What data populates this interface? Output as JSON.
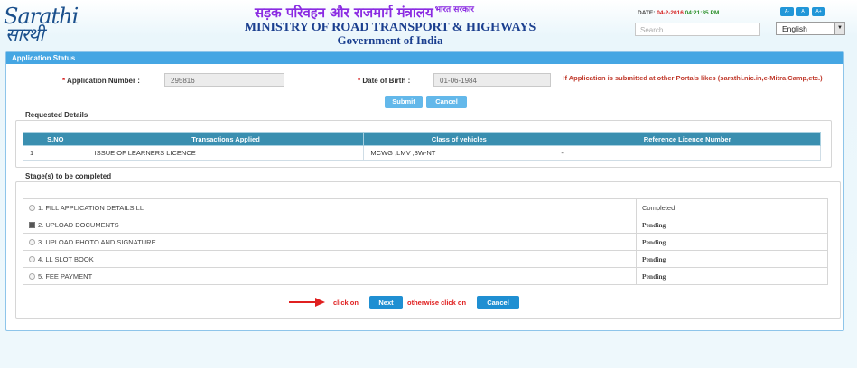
{
  "header": {
    "logo_en": "Sarathi",
    "logo_hi": "सारथी",
    "title_hi": "सड़क परिवहन और राजमार्ग मंत्रालय",
    "title_hi_sup": "भारत सरकार",
    "title_en": "MINISTRY OF ROAD TRANSPORT & HIGHWAYS",
    "title_gov": "Government of India",
    "date_label": "DATE:",
    "date_value": "04-2-2016",
    "time_value": "04:21:35 PM",
    "font_buttons": [
      "A-",
      "A",
      "A+"
    ],
    "search_placeholder": "Search",
    "language": "English"
  },
  "panel": {
    "title": "Application Status",
    "app_number_label": "Application Number :",
    "app_number_value": "295816",
    "dob_label": "Date of Birth :",
    "dob_value": "01-06-1984",
    "portal_note": "If Application is submitted at other Portals likes (sarathi.nic.in,e-Mitra,Camp,etc.)",
    "submit_label": "Submit",
    "cancel_label": "Cancel"
  },
  "requested": {
    "title": "Requested Details",
    "headers": [
      "S.NO",
      "Transactions Applied",
      "Class of vehicles",
      "Reference Licence Number"
    ],
    "rows": [
      [
        "1",
        "ISSUE OF LEARNERS LICENCE",
        "MCWG ,LMV ,3W-NT",
        "-"
      ]
    ]
  },
  "stages": {
    "title": "Stage(s) to be completed",
    "items": [
      {
        "label": "1. FILL APPLICATION DETAILS LL",
        "status": "Completed",
        "control": "radio"
      },
      {
        "label": "2. UPLOAD DOCUMENTS",
        "status": "Pending",
        "control": "checkbox"
      },
      {
        "label": "3. UPLOAD PHOTO AND SIGNATURE",
        "status": "Pending",
        "control": "radio"
      },
      {
        "label": "4. LL SLOT BOOK",
        "status": "Pending",
        "control": "radio"
      },
      {
        "label": "5. FEE PAYMENT",
        "status": "Pending",
        "control": "radio"
      }
    ]
  },
  "actions": {
    "click_on": "click on",
    "next_label": "Next",
    "otherwise": "otherwise click on",
    "cancel_label": "Cancel"
  }
}
